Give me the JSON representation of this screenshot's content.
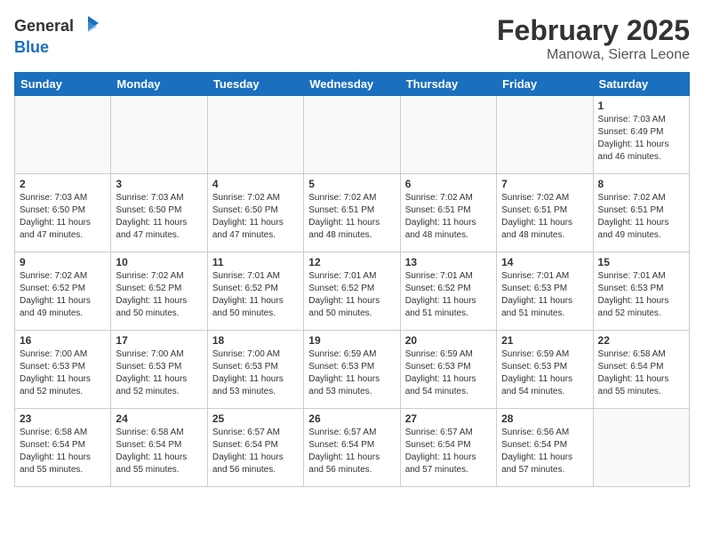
{
  "header": {
    "logo_line1": "General",
    "logo_line2": "Blue",
    "month": "February 2025",
    "location": "Manowa, Sierra Leone"
  },
  "weekdays": [
    "Sunday",
    "Monday",
    "Tuesday",
    "Wednesday",
    "Thursday",
    "Friday",
    "Saturday"
  ],
  "weeks": [
    [
      {
        "day": "",
        "info": ""
      },
      {
        "day": "",
        "info": ""
      },
      {
        "day": "",
        "info": ""
      },
      {
        "day": "",
        "info": ""
      },
      {
        "day": "",
        "info": ""
      },
      {
        "day": "",
        "info": ""
      },
      {
        "day": "1",
        "info": "Sunrise: 7:03 AM\nSunset: 6:49 PM\nDaylight: 11 hours and 46 minutes."
      }
    ],
    [
      {
        "day": "2",
        "info": "Sunrise: 7:03 AM\nSunset: 6:50 PM\nDaylight: 11 hours and 47 minutes."
      },
      {
        "day": "3",
        "info": "Sunrise: 7:03 AM\nSunset: 6:50 PM\nDaylight: 11 hours and 47 minutes."
      },
      {
        "day": "4",
        "info": "Sunrise: 7:02 AM\nSunset: 6:50 PM\nDaylight: 11 hours and 47 minutes."
      },
      {
        "day": "5",
        "info": "Sunrise: 7:02 AM\nSunset: 6:51 PM\nDaylight: 11 hours and 48 minutes."
      },
      {
        "day": "6",
        "info": "Sunrise: 7:02 AM\nSunset: 6:51 PM\nDaylight: 11 hours and 48 minutes."
      },
      {
        "day": "7",
        "info": "Sunrise: 7:02 AM\nSunset: 6:51 PM\nDaylight: 11 hours and 48 minutes."
      },
      {
        "day": "8",
        "info": "Sunrise: 7:02 AM\nSunset: 6:51 PM\nDaylight: 11 hours and 49 minutes."
      }
    ],
    [
      {
        "day": "9",
        "info": "Sunrise: 7:02 AM\nSunset: 6:52 PM\nDaylight: 11 hours and 49 minutes."
      },
      {
        "day": "10",
        "info": "Sunrise: 7:02 AM\nSunset: 6:52 PM\nDaylight: 11 hours and 50 minutes."
      },
      {
        "day": "11",
        "info": "Sunrise: 7:01 AM\nSunset: 6:52 PM\nDaylight: 11 hours and 50 minutes."
      },
      {
        "day": "12",
        "info": "Sunrise: 7:01 AM\nSunset: 6:52 PM\nDaylight: 11 hours and 50 minutes."
      },
      {
        "day": "13",
        "info": "Sunrise: 7:01 AM\nSunset: 6:52 PM\nDaylight: 11 hours and 51 minutes."
      },
      {
        "day": "14",
        "info": "Sunrise: 7:01 AM\nSunset: 6:53 PM\nDaylight: 11 hours and 51 minutes."
      },
      {
        "day": "15",
        "info": "Sunrise: 7:01 AM\nSunset: 6:53 PM\nDaylight: 11 hours and 52 minutes."
      }
    ],
    [
      {
        "day": "16",
        "info": "Sunrise: 7:00 AM\nSunset: 6:53 PM\nDaylight: 11 hours and 52 minutes."
      },
      {
        "day": "17",
        "info": "Sunrise: 7:00 AM\nSunset: 6:53 PM\nDaylight: 11 hours and 52 minutes."
      },
      {
        "day": "18",
        "info": "Sunrise: 7:00 AM\nSunset: 6:53 PM\nDaylight: 11 hours and 53 minutes."
      },
      {
        "day": "19",
        "info": "Sunrise: 6:59 AM\nSunset: 6:53 PM\nDaylight: 11 hours and 53 minutes."
      },
      {
        "day": "20",
        "info": "Sunrise: 6:59 AM\nSunset: 6:53 PM\nDaylight: 11 hours and 54 minutes."
      },
      {
        "day": "21",
        "info": "Sunrise: 6:59 AM\nSunset: 6:53 PM\nDaylight: 11 hours and 54 minutes."
      },
      {
        "day": "22",
        "info": "Sunrise: 6:58 AM\nSunset: 6:54 PM\nDaylight: 11 hours and 55 minutes."
      }
    ],
    [
      {
        "day": "23",
        "info": "Sunrise: 6:58 AM\nSunset: 6:54 PM\nDaylight: 11 hours and 55 minutes."
      },
      {
        "day": "24",
        "info": "Sunrise: 6:58 AM\nSunset: 6:54 PM\nDaylight: 11 hours and 55 minutes."
      },
      {
        "day": "25",
        "info": "Sunrise: 6:57 AM\nSunset: 6:54 PM\nDaylight: 11 hours and 56 minutes."
      },
      {
        "day": "26",
        "info": "Sunrise: 6:57 AM\nSunset: 6:54 PM\nDaylight: 11 hours and 56 minutes."
      },
      {
        "day": "27",
        "info": "Sunrise: 6:57 AM\nSunset: 6:54 PM\nDaylight: 11 hours and 57 minutes."
      },
      {
        "day": "28",
        "info": "Sunrise: 6:56 AM\nSunset: 6:54 PM\nDaylight: 11 hours and 57 minutes."
      },
      {
        "day": "",
        "info": ""
      }
    ]
  ]
}
